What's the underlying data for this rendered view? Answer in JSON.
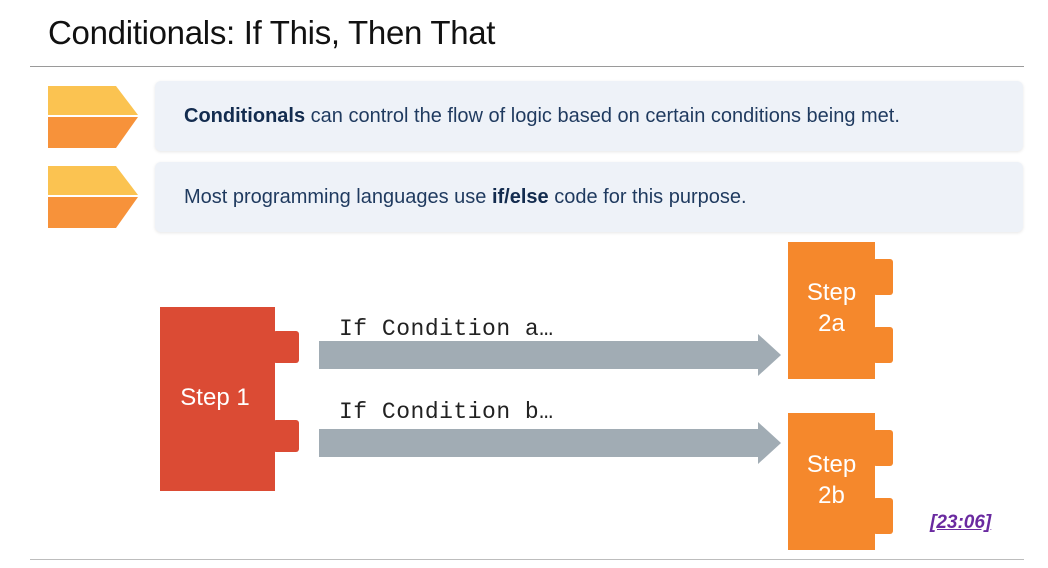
{
  "slide": {
    "title": "Conditionals: If This, Then That"
  },
  "bullets": [
    {
      "bold": "Conditionals",
      "text_after": " can control the flow of logic based on certain conditions being met.",
      "text_before": ""
    },
    {
      "text_before": "Most programming languages use ",
      "bold": "if/else",
      "text_after": " code for this purpose."
    }
  ],
  "diagram": {
    "step1": "Step 1",
    "step2a_line1": "Step",
    "step2a_line2": "2a",
    "step2b_line1": "Step",
    "step2b_line2": "2b",
    "condition_a": "If Condition a…",
    "condition_b": "If Condition b…"
  },
  "timestamp": "[23:06]",
  "colors": {
    "step1": "#db4b34",
    "step2": "#f5882c",
    "arrow": "#a1acb4",
    "chevron_top": "#fbc351",
    "chevron_bottom": "#f7923a",
    "box_bg": "#eef2f8",
    "accent_text": "#1f3a5f"
  }
}
